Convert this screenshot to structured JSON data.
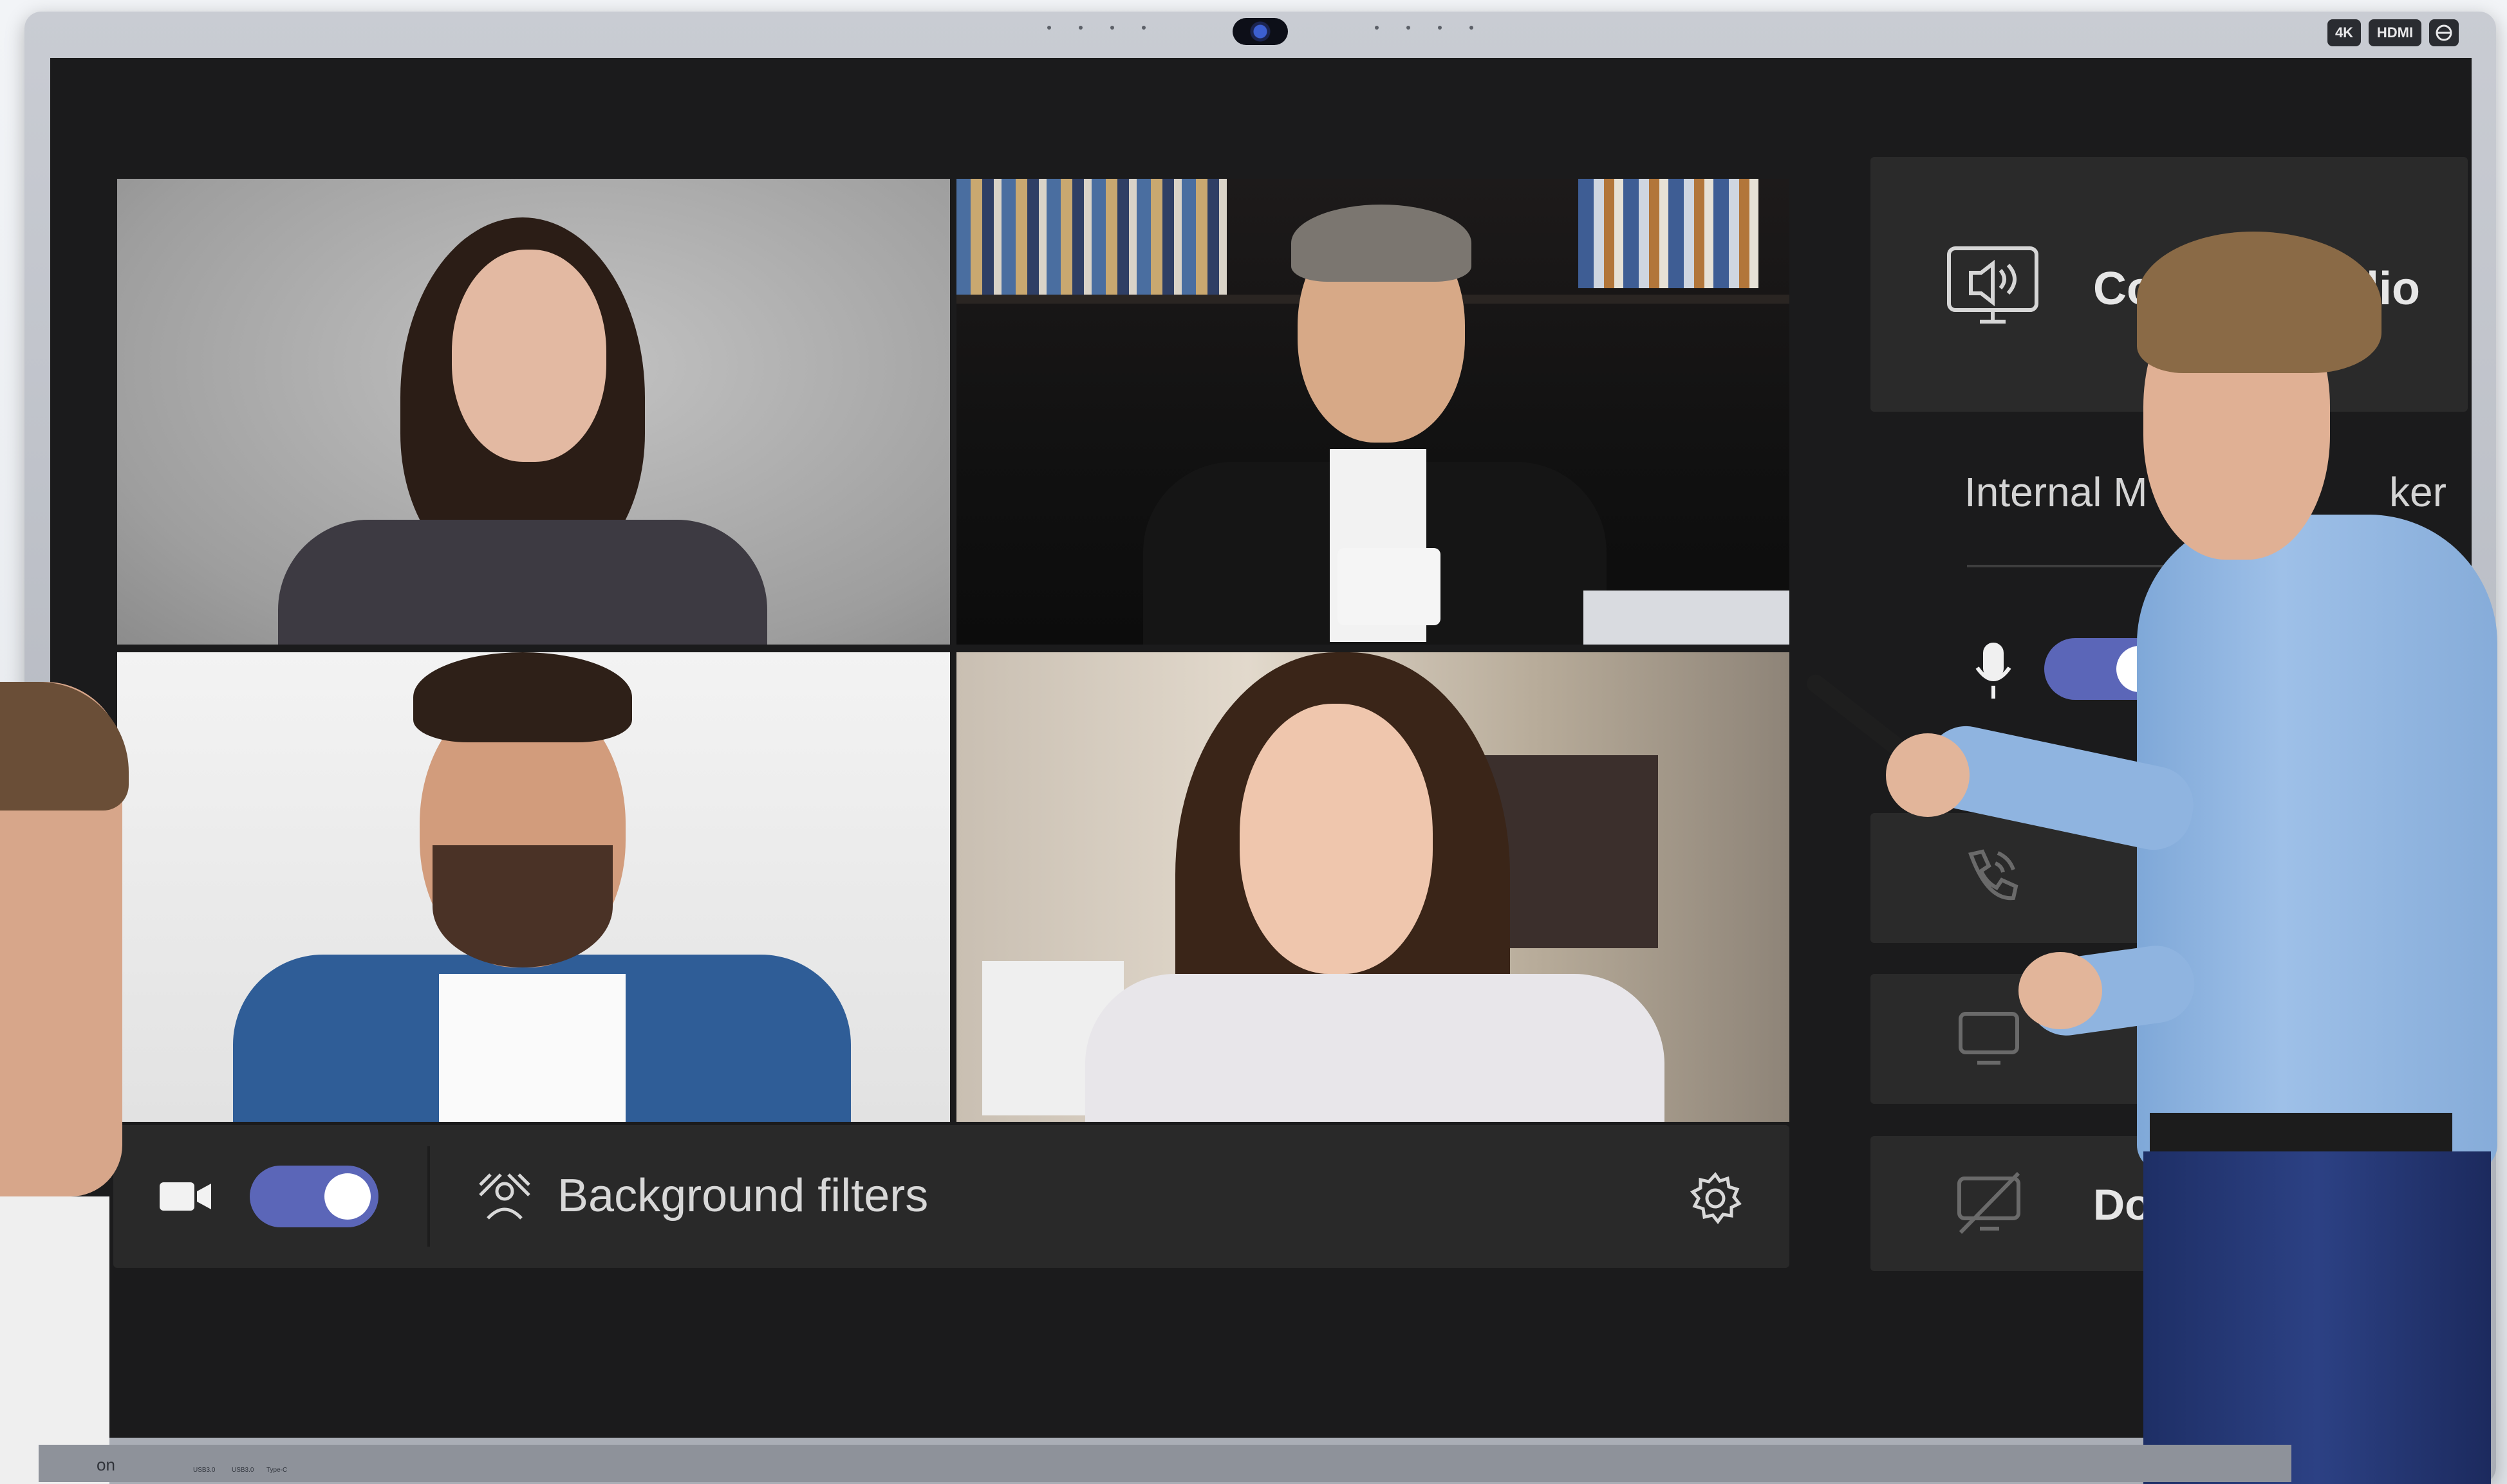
{
  "device": {
    "port_badges": [
      "4K",
      "HDMI",
      ""
    ],
    "brand_label": "on",
    "bottom_ports": [
      "USB3.0",
      "USB3.0",
      "Type-C"
    ]
  },
  "video_grid": {
    "participants": [
      {
        "id": "participant-1"
      },
      {
        "id": "participant-2"
      },
      {
        "id": "participant-3"
      },
      {
        "id": "participant-4"
      }
    ]
  },
  "toolbar": {
    "camera_toggle_on": true,
    "background_filters_label": "Background filters",
    "icons": [
      "video-camera-icon",
      "background-filters-icon",
      "settings-gear-icon"
    ]
  },
  "side_panel": {
    "audio_card_label_visible": "Co",
    "audio_card_label_tail": "dio",
    "speaker_label_visible": "Internal M",
    "speaker_label_tail": "ker",
    "mic_toggle_on": true,
    "bottom_card_label": "Do",
    "icons": [
      "room-audio-icon",
      "microphone-icon",
      "phone-audio-icon",
      "monitor-icon",
      "no-video-icon"
    ]
  },
  "colors": {
    "screen_bg": "#1b1b1c",
    "card_bg": "#2a2a2a",
    "toggle_accent": "#5b66b8"
  }
}
